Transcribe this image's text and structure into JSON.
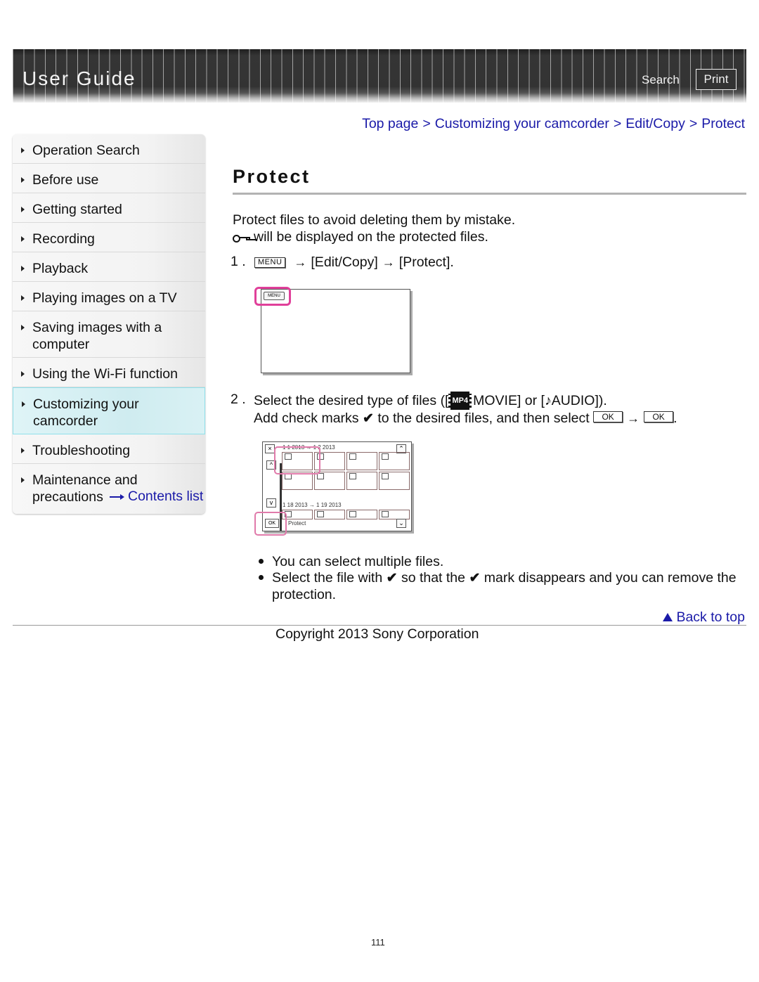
{
  "header": {
    "title": "User Guide",
    "search_label": "Search",
    "print_label": "Print"
  },
  "breadcrumb": [
    {
      "label": "Top page"
    },
    {
      "label": "Customizing your camcorder"
    },
    {
      "label": "Edit/Copy"
    },
    {
      "label": "Protect"
    }
  ],
  "breadcrumb_separator": ">",
  "sidebar": {
    "items": [
      {
        "label": "Operation Search"
      },
      {
        "label": "Before use"
      },
      {
        "label": "Getting started"
      },
      {
        "label": "Recording"
      },
      {
        "label": "Playback"
      },
      {
        "label": "Playing images on a TV"
      },
      {
        "label": "Saving images with a computer"
      },
      {
        "label": "Using the Wi-Fi function"
      },
      {
        "label": "Customizing your camcorder",
        "active": true
      },
      {
        "label": "Troubleshooting"
      },
      {
        "label": "Maintenance and precautions"
      }
    ],
    "contents_link": "Contents list"
  },
  "main": {
    "title": "Protect",
    "intro_line1": "Protect files to avoid deleting them by mistake.",
    "intro_line2": "will be displayed on the protected files.",
    "step1": {
      "number": "1 .",
      "menu_icon": "MENU",
      "arrow": "→",
      "part1": "[Edit/Copy]",
      "part2": "[Protect]."
    },
    "illustration1": {
      "menu_button": "MENU"
    },
    "step2": {
      "number": "2 .",
      "line1_a": "Select the desired type of files ([",
      "movie_icon": "MP4",
      "line1_b": "MOVIE] or [",
      "audio_icon": "♪",
      "line1_c": "AUDIO]).",
      "line2_a": "Add check marks",
      "check_icon": "✔",
      "line2_b": "to the desired files, and then select",
      "ok_label": "OK",
      "arrow": "→",
      "line2_end": "."
    },
    "illustration2": {
      "date_top": "1 1 2013 → 1 2 2013",
      "date_bottom": "1 18 2013 → 1 19 2013",
      "close_icon": "×",
      "up_icon": "^",
      "down_icon": "v",
      "ok_label": "OK",
      "protect_label": "Protect",
      "scroll_up_icon": "⌃",
      "scroll_down_icon": "⌄"
    },
    "notes": [
      {
        "text": "You can select multiple files."
      },
      {
        "text_a": "Select the file with",
        "check": "✔",
        "text_b": "so that the",
        "text_c": "mark disappears and you can remove the",
        "text_d": "protection."
      }
    ],
    "back_to_top": "Back to top"
  },
  "footer": {
    "copyright": "Copyright 2013 Sony Corporation",
    "page_number": "111"
  }
}
